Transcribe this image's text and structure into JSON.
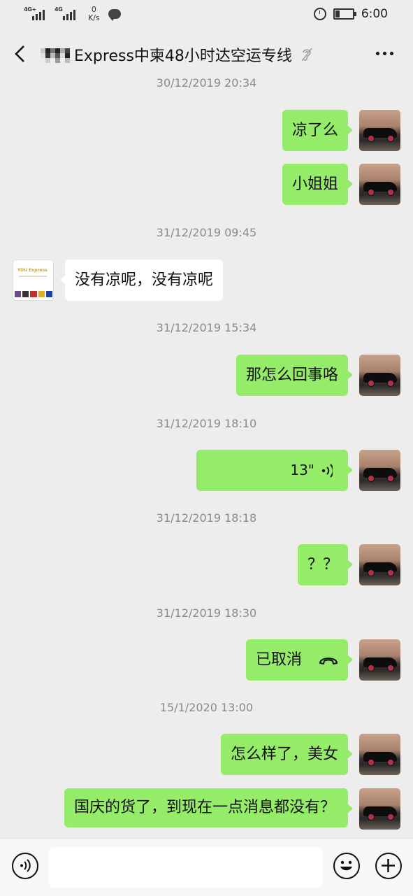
{
  "status_bar": {
    "network_1": "4G+",
    "network_2": "4G",
    "speed_value": "0",
    "speed_unit": "K/s",
    "time": "6:00",
    "battery_percent": 25,
    "icons": [
      "signal-icon",
      "chat-notification-icon",
      "alarm-icon",
      "battery-icon"
    ]
  },
  "header": {
    "title": "Express中柬48小时达空运专线",
    "icons": [
      "back-arrow-icon",
      "ear-mute-icon",
      "more-dots-icon"
    ]
  },
  "messages": [
    {
      "type": "time",
      "text": "30/12/2019 20:34"
    },
    {
      "type": "text",
      "side": "me",
      "text": "凉了么"
    },
    {
      "type": "text",
      "side": "me",
      "text": "小姐姐"
    },
    {
      "type": "time",
      "text": "31/12/2019 09:45"
    },
    {
      "type": "text",
      "side": "them",
      "text": "没有凉呢，没有凉呢",
      "avatar_text": "YOU Express"
    },
    {
      "type": "time",
      "text": "31/12/2019 15:34"
    },
    {
      "type": "text",
      "side": "me",
      "text": "那怎么回事咯"
    },
    {
      "type": "time",
      "text": "31/12/2019 18:10"
    },
    {
      "type": "voice",
      "side": "me",
      "text": "13\""
    },
    {
      "type": "time",
      "text": "31/12/2019 18:18"
    },
    {
      "type": "text",
      "side": "me",
      "text": "？？"
    },
    {
      "type": "time",
      "text": "31/12/2019 18:30"
    },
    {
      "type": "call",
      "side": "me",
      "text": "已取消"
    },
    {
      "type": "time",
      "text": "15/1/2020 13:00"
    },
    {
      "type": "text",
      "side": "me",
      "text": "怎么样了，美女"
    },
    {
      "type": "text",
      "side": "me",
      "text": "国庆的货了，到现在一点消息都没有？"
    }
  ],
  "input_bar": {
    "placeholder": "",
    "value": "",
    "icons": [
      "voice-input-icon",
      "emoji-icon",
      "plus-icon"
    ]
  },
  "colors": {
    "background": "#ededed",
    "my_bubble": "#95ec69",
    "their_bubble": "#ffffff",
    "timestamp": "#8a8a8a"
  }
}
